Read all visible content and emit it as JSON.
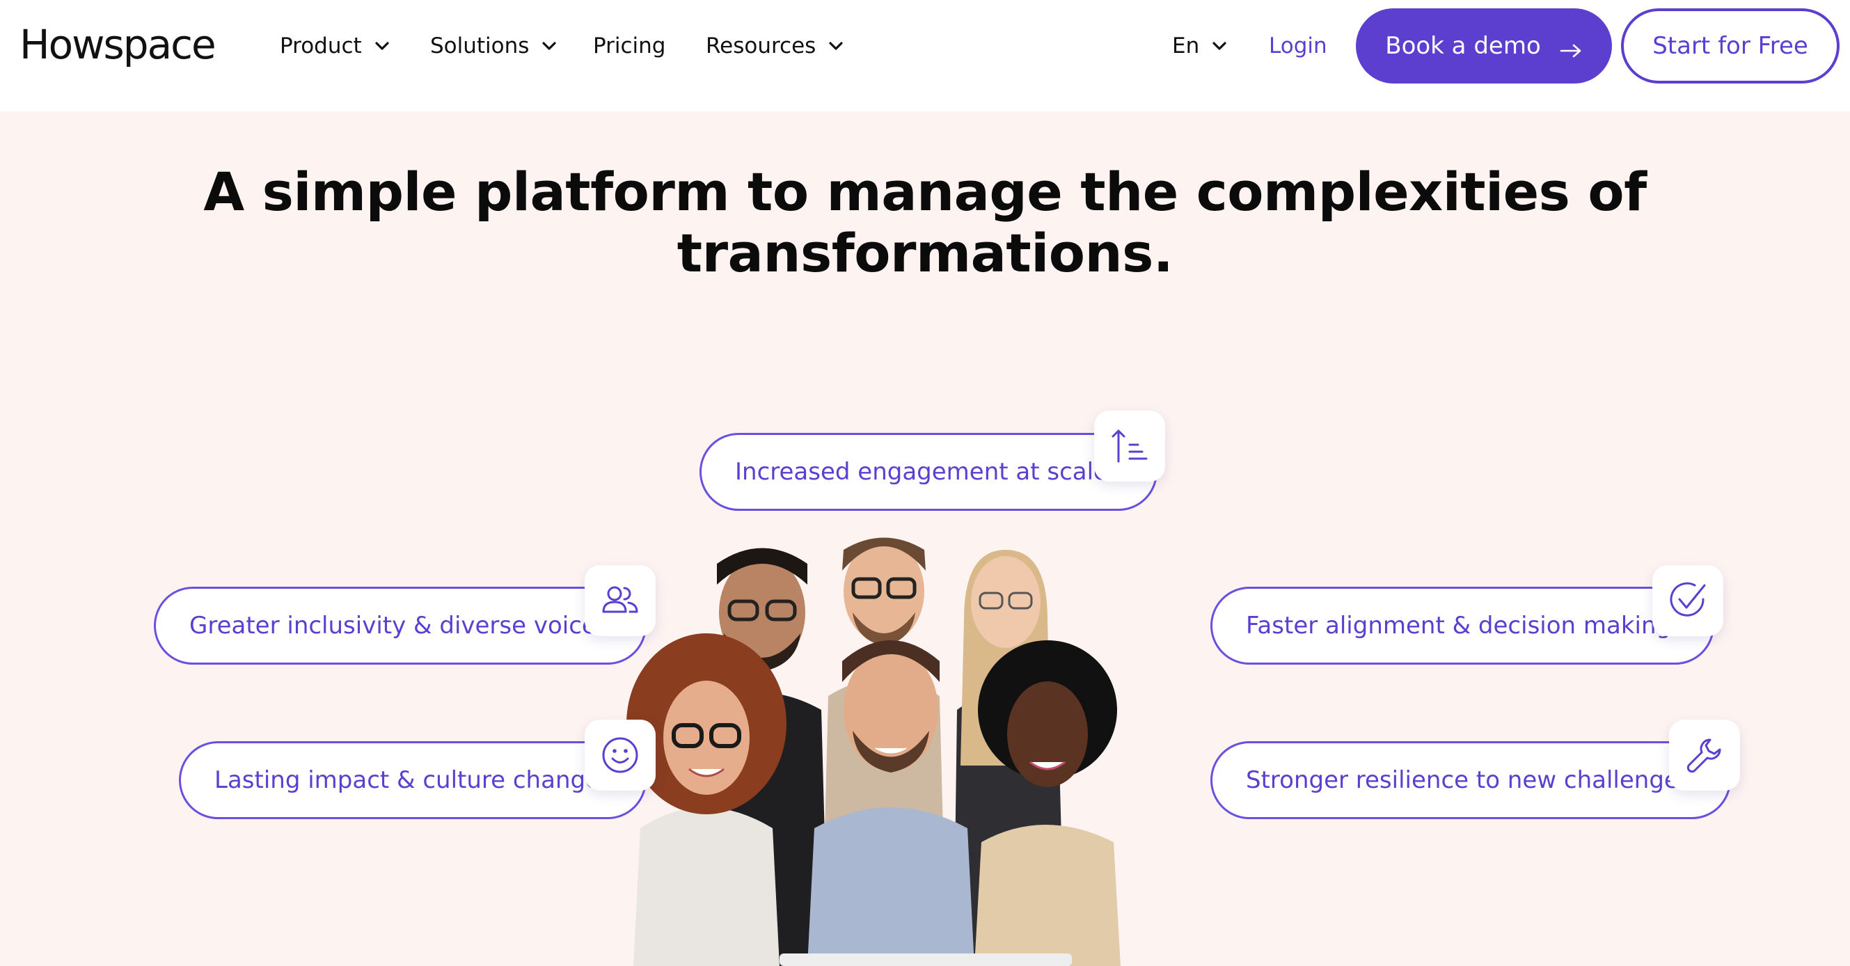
{
  "header": {
    "logo": "Howspace",
    "nav": {
      "product": "Product",
      "solutions": "Solutions",
      "pricing": "Pricing",
      "resources": "Resources"
    },
    "language": "En",
    "login": "Login",
    "book_demo": "Book a demo",
    "start_free": "Start for Free"
  },
  "hero": {
    "headline_line1": "A simple platform to manage the complexities of",
    "headline_line2": "transformations."
  },
  "benefits": {
    "engagement": {
      "label": "Increased engagement at scale",
      "icon": "sort-ascending-icon"
    },
    "inclusivity": {
      "label": "Greater inclusivity & diverse voices",
      "icon": "users-icon"
    },
    "alignment": {
      "label": "Faster alignment & decision making",
      "icon": "check-circle-icon"
    },
    "impact": {
      "label": "Lasting impact & culture change",
      "icon": "smile-icon"
    },
    "resilience": {
      "label": "Stronger resilience to new challenges",
      "icon": "wrench-icon"
    }
  },
  "colors": {
    "accent": "#5d3fd0",
    "background": "#fdf4f2",
    "header_bg": "#ffffff"
  }
}
